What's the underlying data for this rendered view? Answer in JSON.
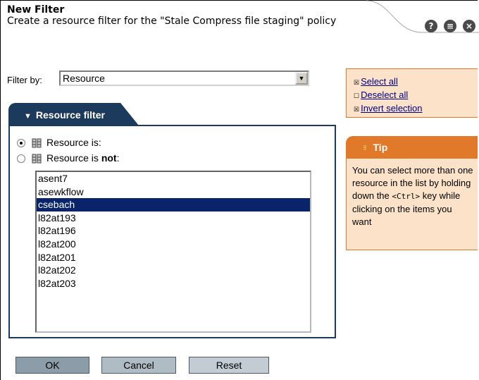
{
  "header": {
    "title": "New Filter",
    "description": "Create a resource filter for the \"Stale Compress file staging\" policy",
    "icons": [
      "help-icon",
      "print-icon",
      "close-icon"
    ]
  },
  "filter": {
    "label": "Filter by:",
    "selected": "Resource"
  },
  "panel": {
    "tab_label": "Resource filter",
    "radio_is_label": "Resource is:",
    "radio_not_prefix": "Resource is ",
    "radio_not_bold": "not",
    "radio_not_suffix": ":",
    "selected_radio": "is"
  },
  "list": {
    "items": [
      "asent7",
      "asewkflow",
      "csebach",
      "l82at193",
      "l82at196",
      "l82at200",
      "l82at201",
      "l82at202",
      "l82at203"
    ],
    "selected_index": 2
  },
  "buttons": {
    "ok": "OK",
    "cancel": "Cancel",
    "reset": "Reset"
  },
  "selection_links": {
    "select_all": "Select all",
    "deselect_all": "Deselect all",
    "invert": "Invert selection"
  },
  "tip": {
    "title": "Tip",
    "text_before": "You can select more than one resource in the list by holding down the ",
    "key": "<Ctrl>",
    "text_after": " key while clicking on the items you want"
  },
  "colors": {
    "panel_navy": "#1c3a5c",
    "tip_orange": "#e07a2a",
    "tip_bg": "#fbe2c8",
    "selection": "#0a246a"
  }
}
